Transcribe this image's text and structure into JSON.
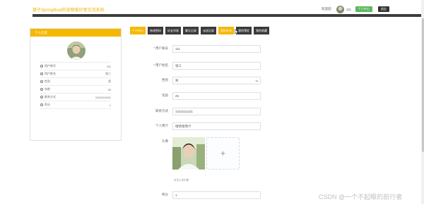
{
  "header": {
    "site_title": "基于SpringBoot的宠物爱好者交流系统",
    "user_label": "欢迎您：",
    "username": "111",
    "personal_center_btn": "个人中心",
    "logout_btn": "退出",
    "band_text": "......"
  },
  "sidebar": {
    "card_title": "个人信息",
    "rows": [
      {
        "icon": "user-icon",
        "label": "用户账号",
        "value": "111"
      },
      {
        "icon": "user-icon",
        "label": "用户姓名",
        "value": "张三"
      },
      {
        "icon": "gender-icon",
        "label": "性别",
        "value": "男"
      },
      {
        "icon": "age-icon",
        "label": "年龄",
        "value": "25"
      },
      {
        "icon": "phone-icon",
        "label": "联系方式",
        "value": "13111111111"
      },
      {
        "icon": "points-icon",
        "label": "积分",
        "value": "1"
      }
    ]
  },
  "tabs": [
    {
      "label": "个人中心",
      "active": true
    },
    {
      "label": "修改密码",
      "active": false
    },
    {
      "label": "好友列表",
      "active": false
    },
    {
      "label": "聊天记录",
      "active": false
    },
    {
      "label": "派送记录",
      "active": false
    },
    {
      "label": "我的发布",
      "active": false
    },
    {
      "label": "我的预定",
      "active": false
    },
    {
      "label": "我的收藏",
      "active": false
    }
  ],
  "form": {
    "account_label": "用户账号",
    "account_value": "111",
    "name_label": "用户姓名",
    "name_value": "张三",
    "gender_label": "性别",
    "gender_value": "男",
    "age_label": "年龄",
    "age_value": "25",
    "phone_label": "联系方式",
    "phone_value": "13111111111",
    "intro_label": "个人简介",
    "intro_value": "哈哈哈简介",
    "avatar_label": "头像",
    "upload_plus": "+",
    "upload_hint": "点击上传头像",
    "points_label": "积分",
    "points_value": "1",
    "required_mark": "*"
  },
  "watermark": "CSDN @一个不起眼的前行者",
  "colors": {
    "accent": "#f5b800",
    "dark_tab": "#3a3a3a",
    "green_btn": "#5db85c"
  }
}
